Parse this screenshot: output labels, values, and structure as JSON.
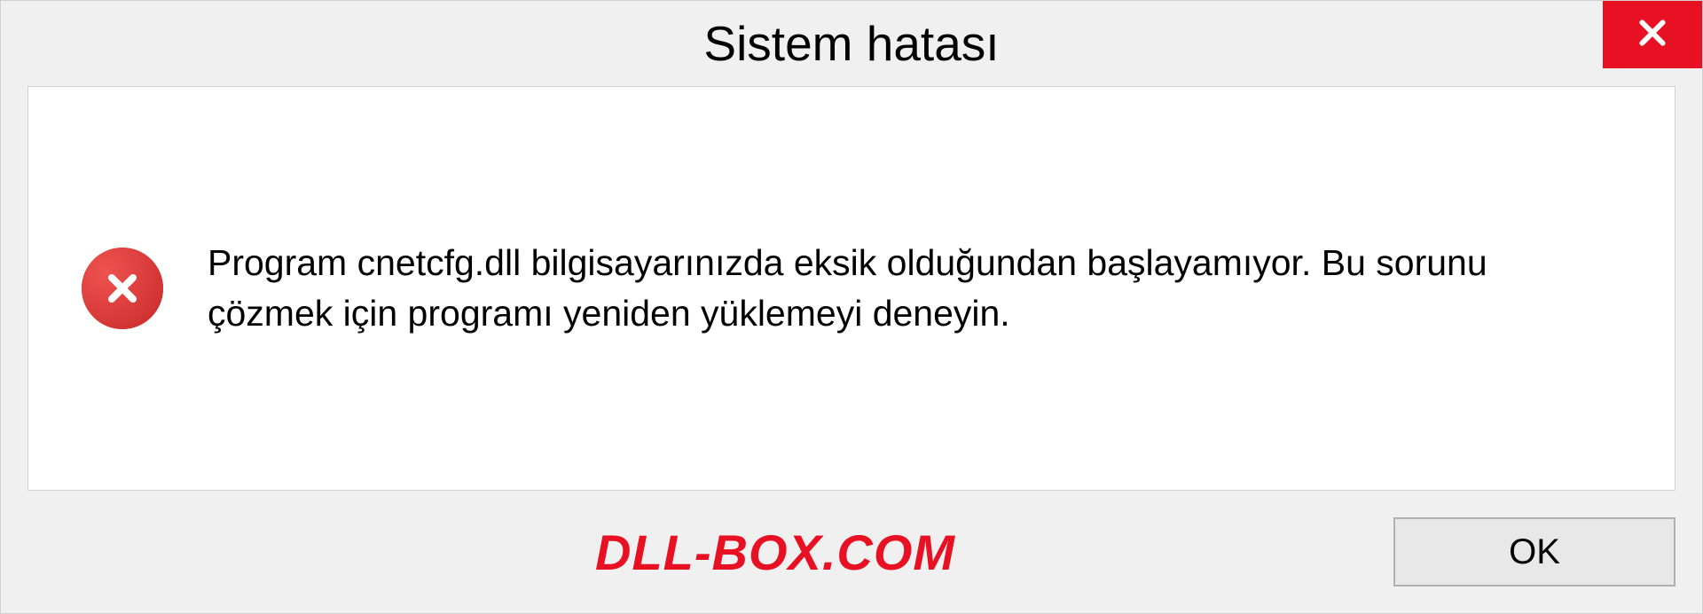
{
  "dialog": {
    "title": "Sistem hatası",
    "message": "Program cnetcfg.dll bilgisayarınızda eksik olduğundan başlayamıyor. Bu sorunu çözmek için programı yeniden yüklemeyi deneyin.",
    "ok_label": "OK"
  },
  "watermark": {
    "text": "DLL-BOX.COM"
  },
  "icons": {
    "close": "close-icon",
    "error": "error-icon"
  }
}
